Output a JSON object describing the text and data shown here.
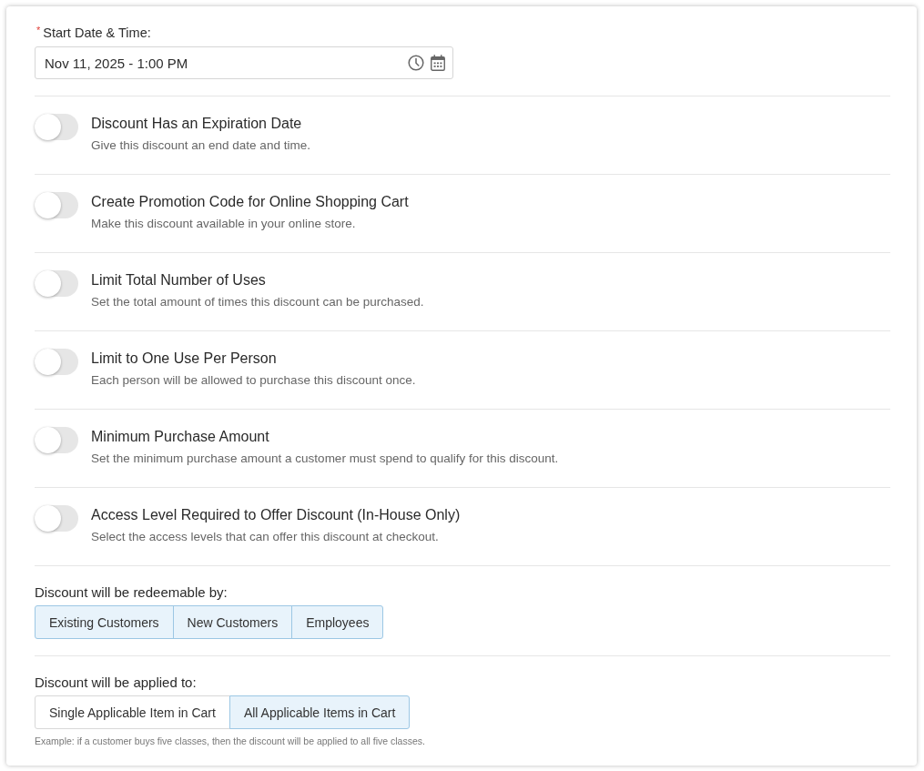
{
  "start_field": {
    "required_mark": "*",
    "label": "Start Date & Time:",
    "value": "Nov 11, 2025 - 1:00 PM"
  },
  "options": [
    {
      "title": "Discount Has an Expiration Date",
      "description": "Give this discount an end date and time.",
      "on": false
    },
    {
      "title": "Create Promotion Code for Online Shopping Cart",
      "description": "Make this discount available in your online store.",
      "on": false
    },
    {
      "title": "Limit Total Number of Uses",
      "description": "Set the total amount of times this discount can be purchased.",
      "on": false
    },
    {
      "title": "Limit to One Use Per Person",
      "description": "Each person will be allowed to purchase this discount once.",
      "on": false
    },
    {
      "title": "Minimum Purchase Amount",
      "description": "Set the minimum purchase amount a customer must spend to qualify for this discount.",
      "on": false
    },
    {
      "title": "Access Level Required to Offer Discount (In-House Only)",
      "description": "Select the access levels that can offer this discount at checkout.",
      "on": false
    }
  ],
  "redeemable": {
    "label": "Discount will be redeemable by:",
    "choices": [
      {
        "label": "Existing Customers",
        "selected": true
      },
      {
        "label": "New Customers",
        "selected": true
      },
      {
        "label": "Employees",
        "selected": true
      }
    ]
  },
  "applied": {
    "label": "Discount will be applied to:",
    "choices": [
      {
        "label": "Single Applicable Item in Cart",
        "selected": false
      },
      {
        "label": "All Applicable Items in Cart",
        "selected": true
      }
    ],
    "note": "Example: if a customer buys five classes, then the discount will be applied to all five classes."
  }
}
